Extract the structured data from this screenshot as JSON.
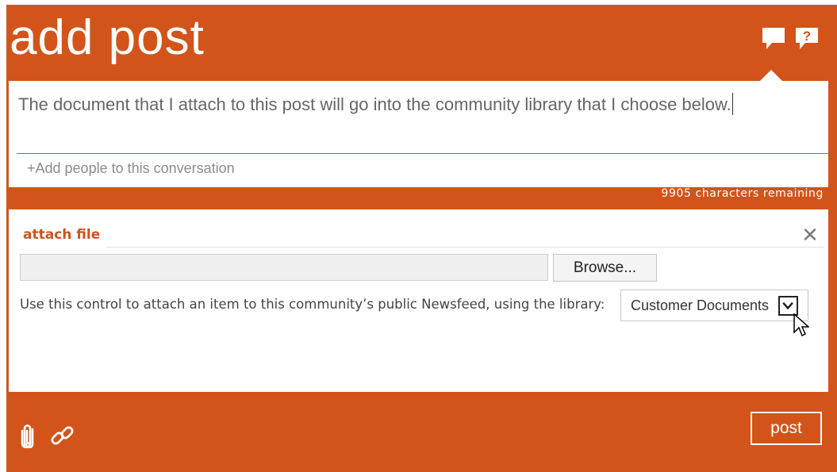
{
  "header": {
    "title": "add post",
    "icons": [
      "comment-icon",
      "help-icon"
    ],
    "help_glyph": "?"
  },
  "compose": {
    "text": "The document that I attach to this post will go into the community library that I choose below.",
    "add_people": "+Add people to this conversation",
    "chars_remaining": "9905 characters remaining"
  },
  "attach": {
    "title": "attach file",
    "close_glyph": "✕",
    "file_value": "",
    "browse_label": "Browse...",
    "description": "Use this control to attach an item to this community’s public Newsfeed, using the library:",
    "library_selected": "Customer Documents"
  },
  "footer": {
    "icons": [
      "paperclip-icon",
      "link-icon"
    ],
    "post_label": "post"
  },
  "colors": {
    "accent": "#d2541a",
    "attach_title": "#c9541f",
    "background": "#ffffff"
  }
}
